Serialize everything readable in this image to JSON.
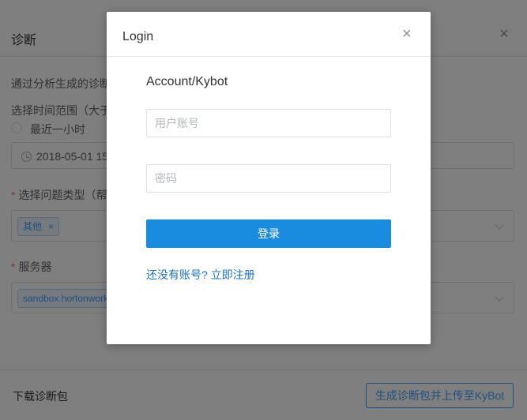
{
  "background": {
    "title": "诊断",
    "close_symbol": "×",
    "intro_text": "通过分析生成的诊断",
    "time_range_label": "选择时间范围（大于",
    "radio_option": "最近一小时",
    "start_time": "2018-05-01 15",
    "issue_type_label": "选择问题类型（帮助",
    "issue_tag": "其他",
    "tag_remove_symbol": "×",
    "server_label": "服务器",
    "server_tag": "sandbox.hortonwork",
    "required_mark": "*",
    "download_label": "下载诊断包",
    "upload_button": "生成诊断包并上传至KyBot"
  },
  "login_modal": {
    "title": "Login",
    "close_symbol": "×",
    "brand": "Account/Kybot",
    "username_placeholder": "用户账号",
    "password_placeholder": "密码",
    "submit_label": "登录",
    "register_link": "还没有账号? 立即注册"
  },
  "colors": {
    "primary": "#1a8ce0",
    "link": "#1a73c7",
    "overlay": "rgba(0,0,0,0.5)"
  }
}
